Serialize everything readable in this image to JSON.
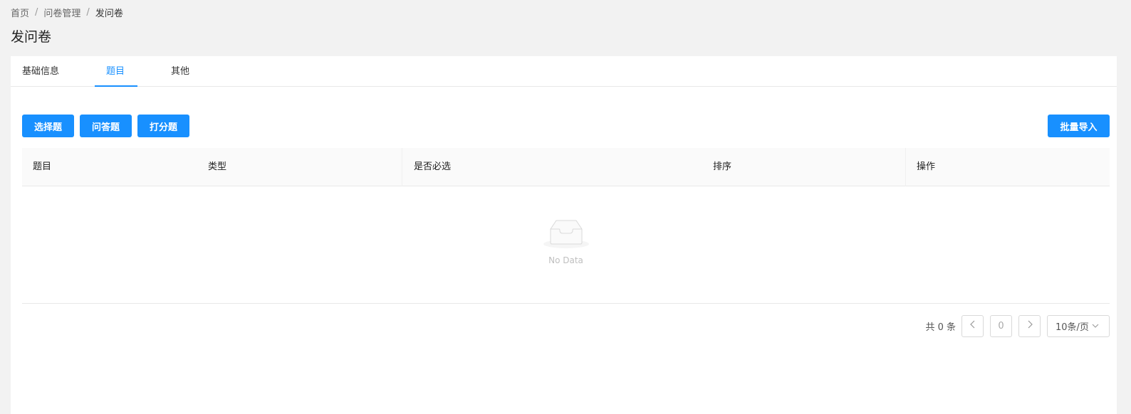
{
  "breadcrumb": {
    "items": [
      "首页",
      "问卷管理",
      "发问卷"
    ],
    "separator": "/"
  },
  "page": {
    "title": "发问卷"
  },
  "tabs": [
    {
      "label": "基础信息",
      "active": false
    },
    {
      "label": "题目",
      "active": true
    },
    {
      "label": "其他",
      "active": false
    }
  ],
  "toolbar": {
    "choice_label": "选择题",
    "qa_label": "问答题",
    "score_label": "打分题",
    "import_label": "批量导入"
  },
  "table": {
    "columns": [
      "题目",
      "类型",
      "是否必选",
      "排序",
      "操作"
    ],
    "rows": [],
    "empty_text": "No Data"
  },
  "pagination": {
    "total_text": "共 0 条",
    "prev_icon": "chevron-left-icon",
    "next_icon": "chevron-right-icon",
    "current_page": "0",
    "page_size": "10条/页"
  },
  "colors": {
    "primary": "#1890ff",
    "background": "#f2f2f2"
  }
}
